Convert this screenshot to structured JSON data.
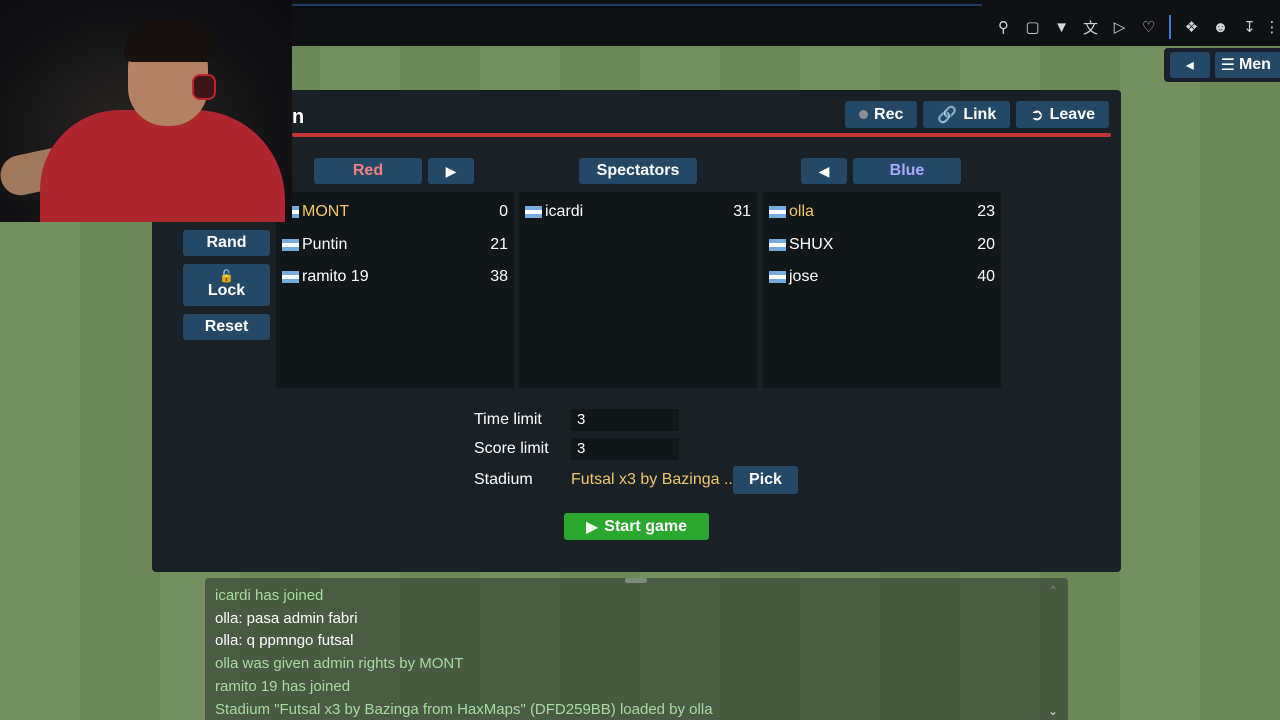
{
  "browser": {
    "icons": [
      "pin-icon",
      "screenshot-icon",
      "pocket-icon",
      "translate-icon",
      "play-icon",
      "heart-icon",
      "extensions-icon",
      "profile-icon",
      "download-icon",
      "more-icon"
    ]
  },
  "top_controls": {
    "menu_label": "Men"
  },
  "room": {
    "title": "n",
    "actions": {
      "rec": "Rec",
      "link": "Link",
      "leave": "Leave"
    },
    "side_buttons": {
      "rand": "Rand",
      "lock": "Lock",
      "reset": "Reset"
    },
    "teams": {
      "red": {
        "label": "Red",
        "color": "#f07f82",
        "players": [
          {
            "name": "MONT",
            "ping": "0",
            "highlight": true
          },
          {
            "name": "Puntin",
            "ping": "21"
          },
          {
            "name": "ramito 19",
            "ping": "38"
          }
        ]
      },
      "spectators": {
        "label": "Spectators",
        "players": [
          {
            "name": "icardi",
            "ping": "31"
          }
        ]
      },
      "blue": {
        "label": "Blue",
        "color": "#a8a8ff",
        "players": [
          {
            "name": "olla",
            "ping": "23",
            "highlight": true
          },
          {
            "name": "SHUX",
            "ping": "20"
          },
          {
            "name": "jose",
            "ping": "40"
          }
        ]
      }
    },
    "settings": {
      "time_limit_label": "Time limit",
      "time_limit_value": "3",
      "score_limit_label": "Score limit",
      "score_limit_value": "3",
      "stadium_label": "Stadium",
      "stadium_value": "Futsal x3 by Bazinga ...",
      "pick_label": "Pick"
    },
    "start_label": "Start game"
  },
  "chat": {
    "lines": [
      {
        "text": "icardi has joined",
        "kind": "sys"
      },
      {
        "text": "olla: pasa admin fabri",
        "kind": "msg"
      },
      {
        "text": "olla: q ppmngo futsal",
        "kind": "msg"
      },
      {
        "text": "olla was given admin rights by MONT",
        "kind": "sys"
      },
      {
        "text": "ramito 19 has joined",
        "kind": "sys"
      },
      {
        "text": "Stadium \"Futsal x3 by Bazinga from HaxMaps\" (DFD259BB) loaded by olla",
        "kind": "sys"
      }
    ]
  },
  "colors": {
    "panel_bg": "#1a2126",
    "button_bg": "#244967",
    "divider": "#c13535",
    "start_green": "#2aa72f",
    "highlight_yellow": "#f3c56a"
  }
}
